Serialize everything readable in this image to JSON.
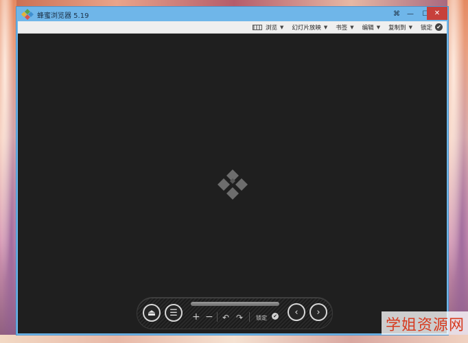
{
  "window": {
    "title": "蜂蜜浏览器 5.19",
    "accent_color": "#6fb6e9",
    "close_color": "#c7403b"
  },
  "titlebar_buttons": {
    "pin_icon": "pin-icon",
    "min_icon": "minimize-icon",
    "max_icon": "maximize-icon",
    "close_icon": "close-icon"
  },
  "toolbar": {
    "browse_label": "浏览",
    "slideshow_label": "幻灯片放映",
    "bookmarks_label": "书签",
    "edit_label": "编辑",
    "copy_to_label": "复制到",
    "lock_label": "锁定"
  },
  "viewer": {
    "background_color": "#1f1f1f"
  },
  "controls": {
    "lock_label": "锁定",
    "plus_glyph": "+",
    "minus_glyph": "−",
    "undo_glyph": "↶",
    "redo_glyph": "↷",
    "eject_glyph": "⏏",
    "menu_glyph": "☰",
    "prev_glyph": "‹",
    "next_glyph": "›",
    "check_glyph": "✔"
  },
  "watermark": {
    "text": "学姐资源网"
  }
}
